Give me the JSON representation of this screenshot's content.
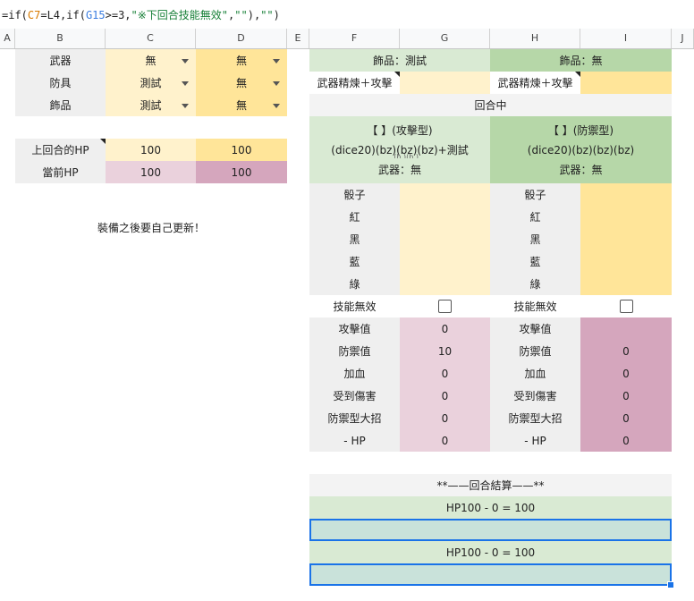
{
  "formula": {
    "prefix": "=if(",
    "ref1": "C7",
    "mid1": "=L4,if(",
    "ref2": "G15",
    "mid2": ">=3,",
    "str1": "\"※下回合技能無效\"",
    "mid3": ",",
    "str2": "\"\"",
    "mid4": "),",
    "str3": "\"\"",
    "suffix": ")"
  },
  "columns": [
    "A",
    "B",
    "C",
    "D",
    "E",
    "F",
    "G",
    "H",
    "I",
    "J"
  ],
  "equipment": {
    "rows": [
      {
        "label": "武器",
        "c": "無",
        "d": "無"
      },
      {
        "label": "防具",
        "c": "測試",
        "d": "無"
      },
      {
        "label": "飾品",
        "c": "測試",
        "d": "無"
      }
    ]
  },
  "hp": {
    "prev_label": "上回合的HP",
    "prev_c": "100",
    "prev_d": "100",
    "curr_label": "當前HP",
    "curr_c": "100",
    "curr_d": "100"
  },
  "note": "裝備之後要自己更新！",
  "left_panel": {
    "accessory": "飾品：測試",
    "refine_label": "武器精煉＋攻擊",
    "type_title": "【 】(攻擊型)",
    "dice": "(dice20)(bz)(bz)(bz)+測試",
    "dice_overflow": "(b )(b )",
    "weapon": "武器：無"
  },
  "right_panel": {
    "accessory": "飾品：無",
    "refine_label": "武器精煉＋攻擊",
    "type_title": "【 】(防禦型)",
    "dice": "(dice20)(bz)(bz)(bz)",
    "weapon": "武器：無"
  },
  "round_label": "回合中",
  "dice_rows": [
    "骰子",
    "紅",
    "黑",
    "藍",
    "綠"
  ],
  "skill_disable_label": "技能無效",
  "stats": {
    "labels": [
      "攻擊值",
      "防禦值",
      "加血",
      "受到傷害",
      "防禦型大招",
      "- HP"
    ],
    "left_values": [
      "0",
      "10",
      "0",
      "0",
      "0",
      "0"
    ],
    "right_values": [
      "",
      "0",
      "0",
      "0",
      "0",
      "0"
    ]
  },
  "settlement": {
    "title": "**——回合結算——**",
    "line1": "HP100 - 0 = 100",
    "line2": "HP100 - 0 = 100"
  },
  "colors": {
    "cream": "#fff2cc",
    "yellow": "#ffe599",
    "pink": "#ead1dc",
    "mauve": "#d5a6bd",
    "light_green": "#d9ead3",
    "green": "#b6d7a8",
    "teal": "#c9e2da",
    "selection": "#1a73e8"
  }
}
